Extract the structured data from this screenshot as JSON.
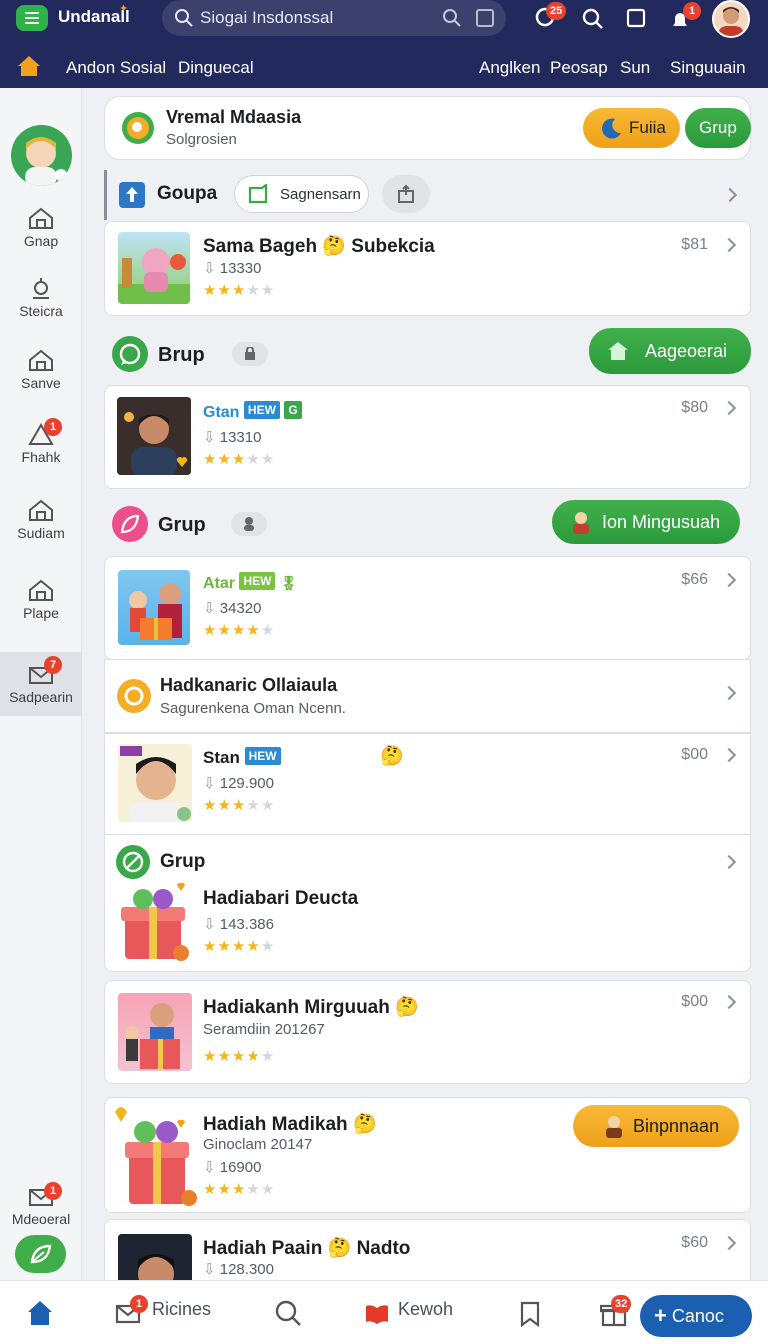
{
  "header": {
    "app_name": "Undanall",
    "search_placeholder": "Siogai Insdonssal",
    "badges": {
      "updates": "25",
      "alerts": "1"
    }
  },
  "top_nav": {
    "left": [
      "Andon Sosial",
      "Dinguecal"
    ],
    "right": [
      "Anglken",
      "Peosap",
      "Sun",
      "Singuuain"
    ],
    "active": "Anglken"
  },
  "sidebar": {
    "items": [
      {
        "label": "Gnap"
      },
      {
        "label": "Steicra"
      },
      {
        "label": "Sanve"
      },
      {
        "label": "Fhahk",
        "badge": "1"
      },
      {
        "label": "Sudiam"
      },
      {
        "label": "Plape"
      },
      {
        "label": "Sadpearin",
        "badge": "7"
      }
    ],
    "bottom_item": {
      "label": "Mdeoeral",
      "badge": "1"
    }
  },
  "banner": {
    "title": "Vremal Mdaasia",
    "subtitle": "Solgrosien",
    "btn_orange": "Fuiia",
    "btn_green": "Grup"
  },
  "section1": {
    "title": "Goupa",
    "chip": "Sagnensarn"
  },
  "item1": {
    "title": "Sama Bageh",
    "title_tail": "Subekcia",
    "count": "13330",
    "price": "$81",
    "rating": 3
  },
  "section2": {
    "title": "Brup",
    "action": "Aageoerai"
  },
  "item2": {
    "title": "Gtan",
    "tag": "HEW",
    "count": "13310",
    "price": "$80",
    "rating": 3
  },
  "section3": {
    "title": "Grup",
    "action": "Ion Mingusuah"
  },
  "item3": {
    "title": "Atar",
    "tag": "HEW",
    "count": "34320",
    "price": "$66",
    "rating": 4
  },
  "item4": {
    "title": "Hadkanaric Ollaiaula",
    "subtitle": "Sagurenkena Oman Ncenn."
  },
  "item5": {
    "title": "Stan",
    "tag": "HEW",
    "count": "129.900",
    "price": "$00",
    "rating": 3
  },
  "item6": {
    "section": "Grup",
    "title": "Hadiabari Deucta",
    "count": "143.386",
    "rating": 4
  },
  "item7": {
    "title": "Hadiakanh Mirguuah",
    "subtitle": "Seramdiin 201267",
    "price": "$00",
    "rating": 4
  },
  "item8": {
    "title": "Hadiah Madikah",
    "subtitle": "Ginoclam 20147",
    "count": "16900",
    "action": "Binpnnaan",
    "rating": 3
  },
  "item9": {
    "title": "Hadiah Paain",
    "title_tail": "Nadto",
    "count": "128.300",
    "price": "$60"
  },
  "bottom_nav": {
    "messages": "Ricines",
    "messages_badge": "1",
    "hot": "Kewoh",
    "gift_badge": "32",
    "cta": "Canoc"
  },
  "colors": {
    "header": "#22295c",
    "green": "#3aa84a",
    "orange": "#f4ad26",
    "accent": "#1b5fb0"
  }
}
